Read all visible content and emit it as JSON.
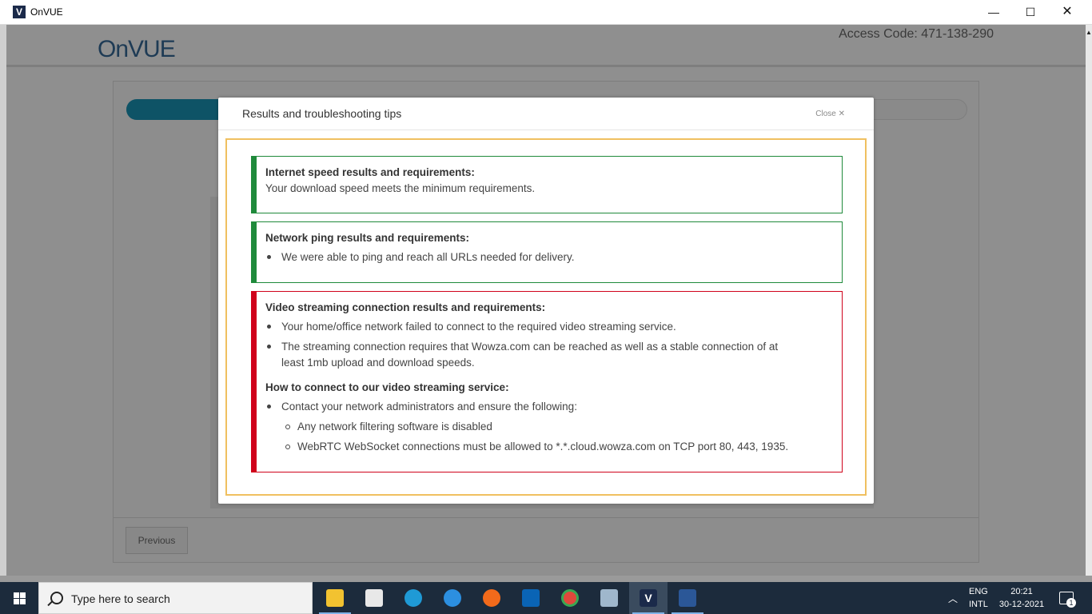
{
  "window": {
    "icon_letter": "V",
    "title": "OnVUE",
    "minimize": "—",
    "maximize": "☐",
    "close": "✕"
  },
  "header": {
    "logo": "OnVUE",
    "access_code": "Access Code: 471-138-290"
  },
  "footer": {
    "previous_label": "Previous"
  },
  "modal": {
    "title": "Results and troubleshooting tips",
    "close_label": "Close ✕",
    "internet": {
      "heading": "Internet speed results and requirements:",
      "text": "Your download speed meets the minimum requirements.",
      "status_color": "#1f8a3b"
    },
    "ping": {
      "heading": "Network ping results and requirements:",
      "bullets": [
        "We were able to ping and reach all URLs needed for delivery."
      ],
      "status_color": "#1f8a3b"
    },
    "video": {
      "heading": "Video streaming connection results and requirements:",
      "bullets": [
        "Your home/office network failed to connect to the required video streaming service.",
        "The streaming connection requires that Wowza.com can be reached as well as a stable connection of at",
        "least 1mb upload and download speeds."
      ],
      "howto_heading": "How to connect to our video streaming service:",
      "howto_bullet": "Contact your network administrators and ensure the following:",
      "sub_bullets": [
        "Any network filtering software is disabled",
        "WebRTC WebSocket connections must be allowed to *.*.cloud.wowza.com on TCP port 80, 443, 1935."
      ],
      "status_color": "#d0021b"
    }
  },
  "taskbar": {
    "search_placeholder": "Type here to search",
    "apps": [
      "file-explorer",
      "microsoft-store",
      "edge",
      "internet-explorer",
      "firefox",
      "outlook",
      "chrome",
      "resource-monitor",
      "onvue",
      "word"
    ],
    "lang_line1": "ENG",
    "lang_line2": "INTL",
    "time": "20:21",
    "date": "30-12-2021",
    "notification_count": "1"
  }
}
